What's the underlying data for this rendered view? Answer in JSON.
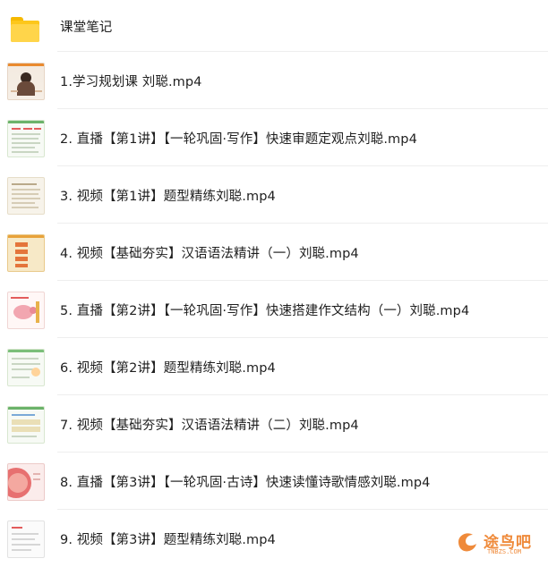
{
  "folder": {
    "name": "课堂笔记",
    "icon": "folder-icon"
  },
  "files": [
    {
      "name": "1.学习规划课 刘聪.mp4"
    },
    {
      "name": "2. 直播【第1讲】【一轮巩固·写作】快速审题定观点刘聪.mp4"
    },
    {
      "name": "3. 视频【第1讲】题型精练刘聪.mp4"
    },
    {
      "name": "4. 视频【基础夯实】汉语语法精讲（一）刘聪.mp4"
    },
    {
      "name": "5. 直播【第2讲】【一轮巩固·写作】快速搭建作文结构（一）刘聪.mp4"
    },
    {
      "name": "6. 视频【第2讲】题型精练刘聪.mp4"
    },
    {
      "name": "7. 视频【基础夯实】汉语语法精讲（二）刘聪.mp4"
    },
    {
      "name": "8. 直播【第3讲】【一轮巩固·古诗】快速读懂诗歌情感刘聪.mp4"
    },
    {
      "name": "9. 视频【第3讲】题型精练刘聪.mp4"
    }
  ],
  "watermark": {
    "title": "途鸟吧",
    "subtitle": "TNBZS.COM"
  }
}
